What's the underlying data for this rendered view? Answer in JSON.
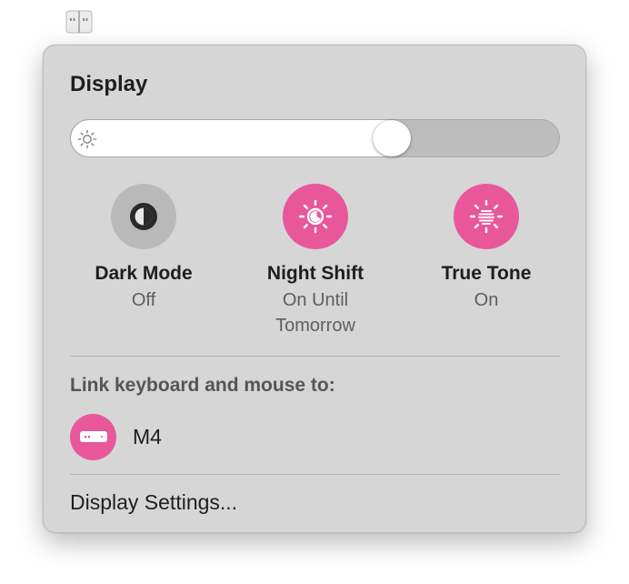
{
  "menubar": {
    "icon": "display-mirroring-icon"
  },
  "panel": {
    "title": "Display",
    "brightness": {
      "icon": "sun-icon",
      "level": 0.67
    },
    "toggles": [
      {
        "label": "Dark Mode",
        "status": "Off",
        "icon": "dark-mode-icon",
        "active": false
      },
      {
        "label": "Night Shift",
        "status": "On Until Tomorrow",
        "icon": "night-shift-icon",
        "active": true
      },
      {
        "label": "True Tone",
        "status": "On",
        "icon": "true-tone-icon",
        "active": true
      }
    ],
    "link_section": {
      "label": "Link keyboard and mouse to:",
      "devices": [
        {
          "name": "M4",
          "icon": "mac-mini-icon"
        }
      ]
    },
    "settings_label": "Display Settings..."
  },
  "colors": {
    "accent": "#e9579b",
    "inactive_toggle": "#b9b9b9",
    "panel_bg": "#d6d6d6"
  }
}
